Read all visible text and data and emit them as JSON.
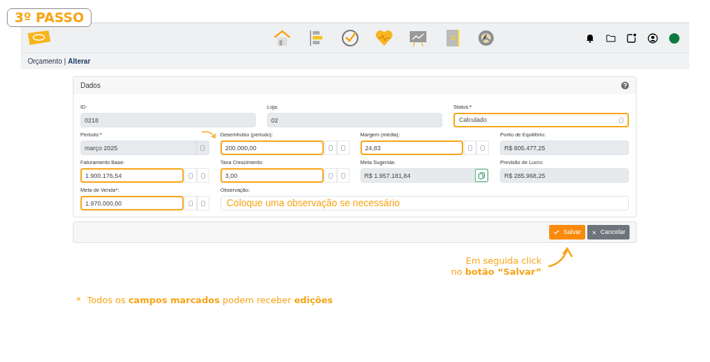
{
  "step_badge": "3º PASSO",
  "breadcrumb": {
    "section": "Orçamento",
    "separator": "|",
    "current": "Alterar"
  },
  "panel": {
    "title": "Dados"
  },
  "rows": [
    [
      {
        "label": "ID:",
        "value": "0218",
        "kind": "plain",
        "readonly": true,
        "highlighted": false
      },
      {
        "label": "Loja:",
        "value": "02",
        "kind": "plain",
        "readonly": true,
        "highlighted": false
      },
      {
        "label": "Status:*",
        "value": "Calculado",
        "kind": "select",
        "readonly": false,
        "highlighted": true
      }
    ],
    [
      {
        "label": "Periodo:*",
        "value": "março 2025",
        "kind": "picker",
        "readonly": true,
        "highlighted": false
      },
      {
        "label": "Desembolso (periodo):",
        "value": "200.000,00",
        "kind": "stepper",
        "readonly": false,
        "highlighted": true,
        "pointer": true
      },
      {
        "label": "Margem (média):",
        "value": "24,83",
        "kind": "stepper",
        "readonly": false,
        "highlighted": true
      },
      {
        "label": "Ponto de Equilíbrio:",
        "value": "R$ 805.477,25",
        "kind": "plain",
        "readonly": true,
        "highlighted": false
      }
    ],
    [
      {
        "label": "Faturamento Base:",
        "value": "1.900.176,54",
        "kind": "stepper",
        "readonly": false,
        "highlighted": true
      },
      {
        "label": "Taxa Crescimento:",
        "value": "3,00",
        "kind": "stepper",
        "readonly": false,
        "highlighted": true
      },
      {
        "label": "Meta Sugerida:",
        "value": "R$ 1.957.181,84",
        "kind": "copy",
        "readonly": true,
        "highlighted": false
      },
      {
        "label": "Previsão de Lucro:",
        "value": "R$ 285.968,25",
        "kind": "plain",
        "readonly": true,
        "highlighted": false
      }
    ],
    [
      {
        "label": "Meta de Venda*:",
        "value": "1.970.000,00",
        "kind": "stepper",
        "readonly": false,
        "highlighted": true
      },
      {
        "label": "Observação:",
        "placeholder": "Coloque uma observação se necessário",
        "kind": "note",
        "readonly": false,
        "highlighted": false
      }
    ]
  ],
  "actions": [
    {
      "label": "Salvar",
      "kind": "primary"
    },
    {
      "label": "Cancelar",
      "kind": "secondary"
    }
  ],
  "hint": "Em seguida click\nno **botão “Salvar”**",
  "footnote": {
    "mark": "*",
    "text": "Todos os **campos marcados** podem receber **edições**"
  }
}
